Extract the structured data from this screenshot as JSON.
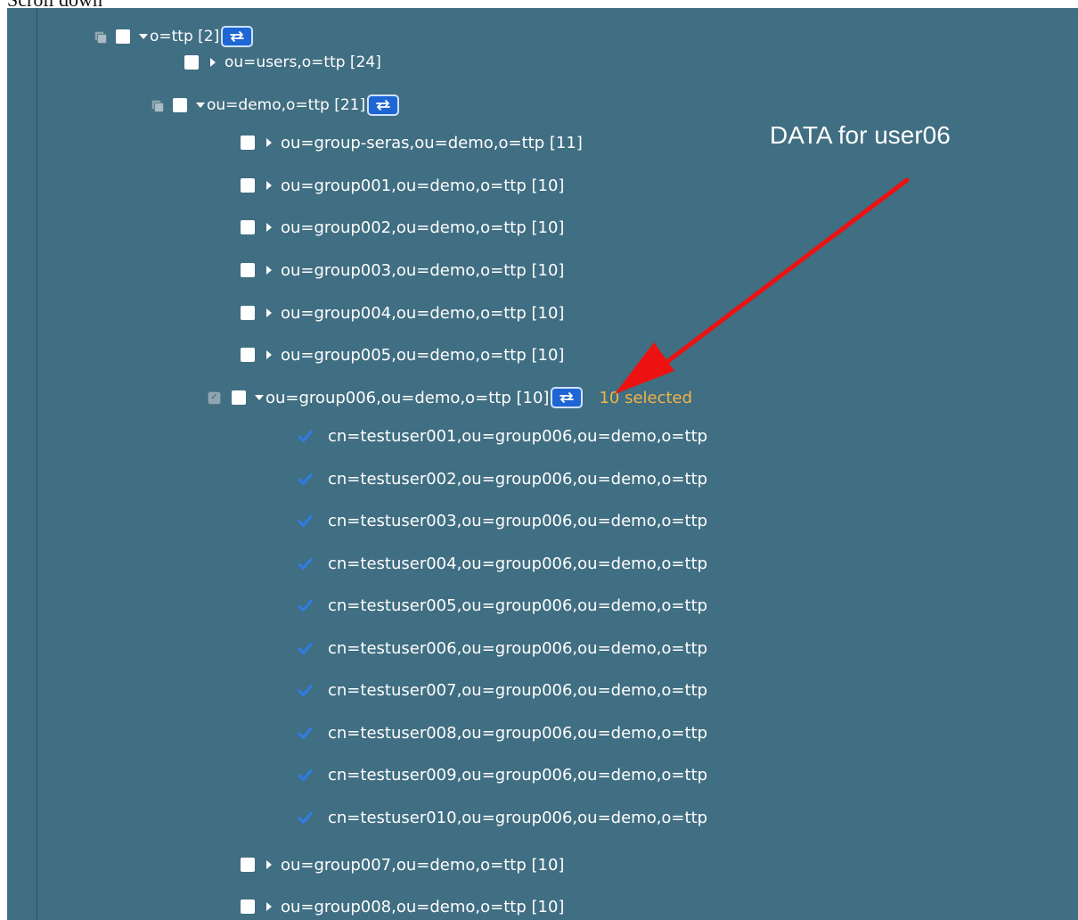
{
  "caption": "Scroll down",
  "annotation": {
    "text": "DATA for user06",
    "arrow_color": "#ee1111"
  },
  "colors": {
    "panel_bg": "#406e82",
    "text": "#ffffff",
    "accent_button": "#1e66d4",
    "selected_count": "#f0b548",
    "check_icon": "#2f7de1"
  },
  "tree": {
    "root": {
      "label": "o=ttp [2]"
    },
    "users": {
      "label": "ou=users,o=ttp [24]"
    },
    "demo": {
      "label": "ou=demo,o=ttp [21]"
    },
    "groups_before": [
      {
        "label": "ou=group-seras,ou=demo,o=ttp [11]"
      },
      {
        "label": "ou=group001,ou=demo,o=ttp [10]"
      },
      {
        "label": "ou=group002,ou=demo,o=ttp [10]"
      },
      {
        "label": "ou=group003,ou=demo,o=ttp [10]"
      },
      {
        "label": "ou=group004,ou=demo,o=ttp [10]"
      },
      {
        "label": "ou=group005,ou=demo,o=ttp [10]"
      }
    ],
    "group006": {
      "label": "ou=group006,ou=demo,o=ttp [10]",
      "selected_text": "10 selected"
    },
    "users_in_group006": [
      {
        "label": "cn=testuser001,ou=group006,ou=demo,o=ttp",
        "checked": true
      },
      {
        "label": "cn=testuser002,ou=group006,ou=demo,o=ttp",
        "checked": true
      },
      {
        "label": "cn=testuser003,ou=group006,ou=demo,o=ttp",
        "checked": true
      },
      {
        "label": "cn=testuser004,ou=group006,ou=demo,o=ttp",
        "checked": true
      },
      {
        "label": "cn=testuser005,ou=group006,ou=demo,o=ttp",
        "checked": true
      },
      {
        "label": "cn=testuser006,ou=group006,ou=demo,o=ttp",
        "checked": true
      },
      {
        "label": "cn=testuser007,ou=group006,ou=demo,o=ttp",
        "checked": true
      },
      {
        "label": "cn=testuser008,ou=group006,ou=demo,o=ttp",
        "checked": true
      },
      {
        "label": "cn=testuser009,ou=group006,ou=demo,o=ttp",
        "checked": true
      },
      {
        "label": "cn=testuser010,ou=group006,ou=demo,o=ttp",
        "checked": true
      }
    ],
    "groups_after": [
      {
        "label": "ou=group007,ou=demo,o=ttp [10]"
      },
      {
        "label": "ou=group008,ou=demo,o=ttp [10]"
      }
    ]
  }
}
